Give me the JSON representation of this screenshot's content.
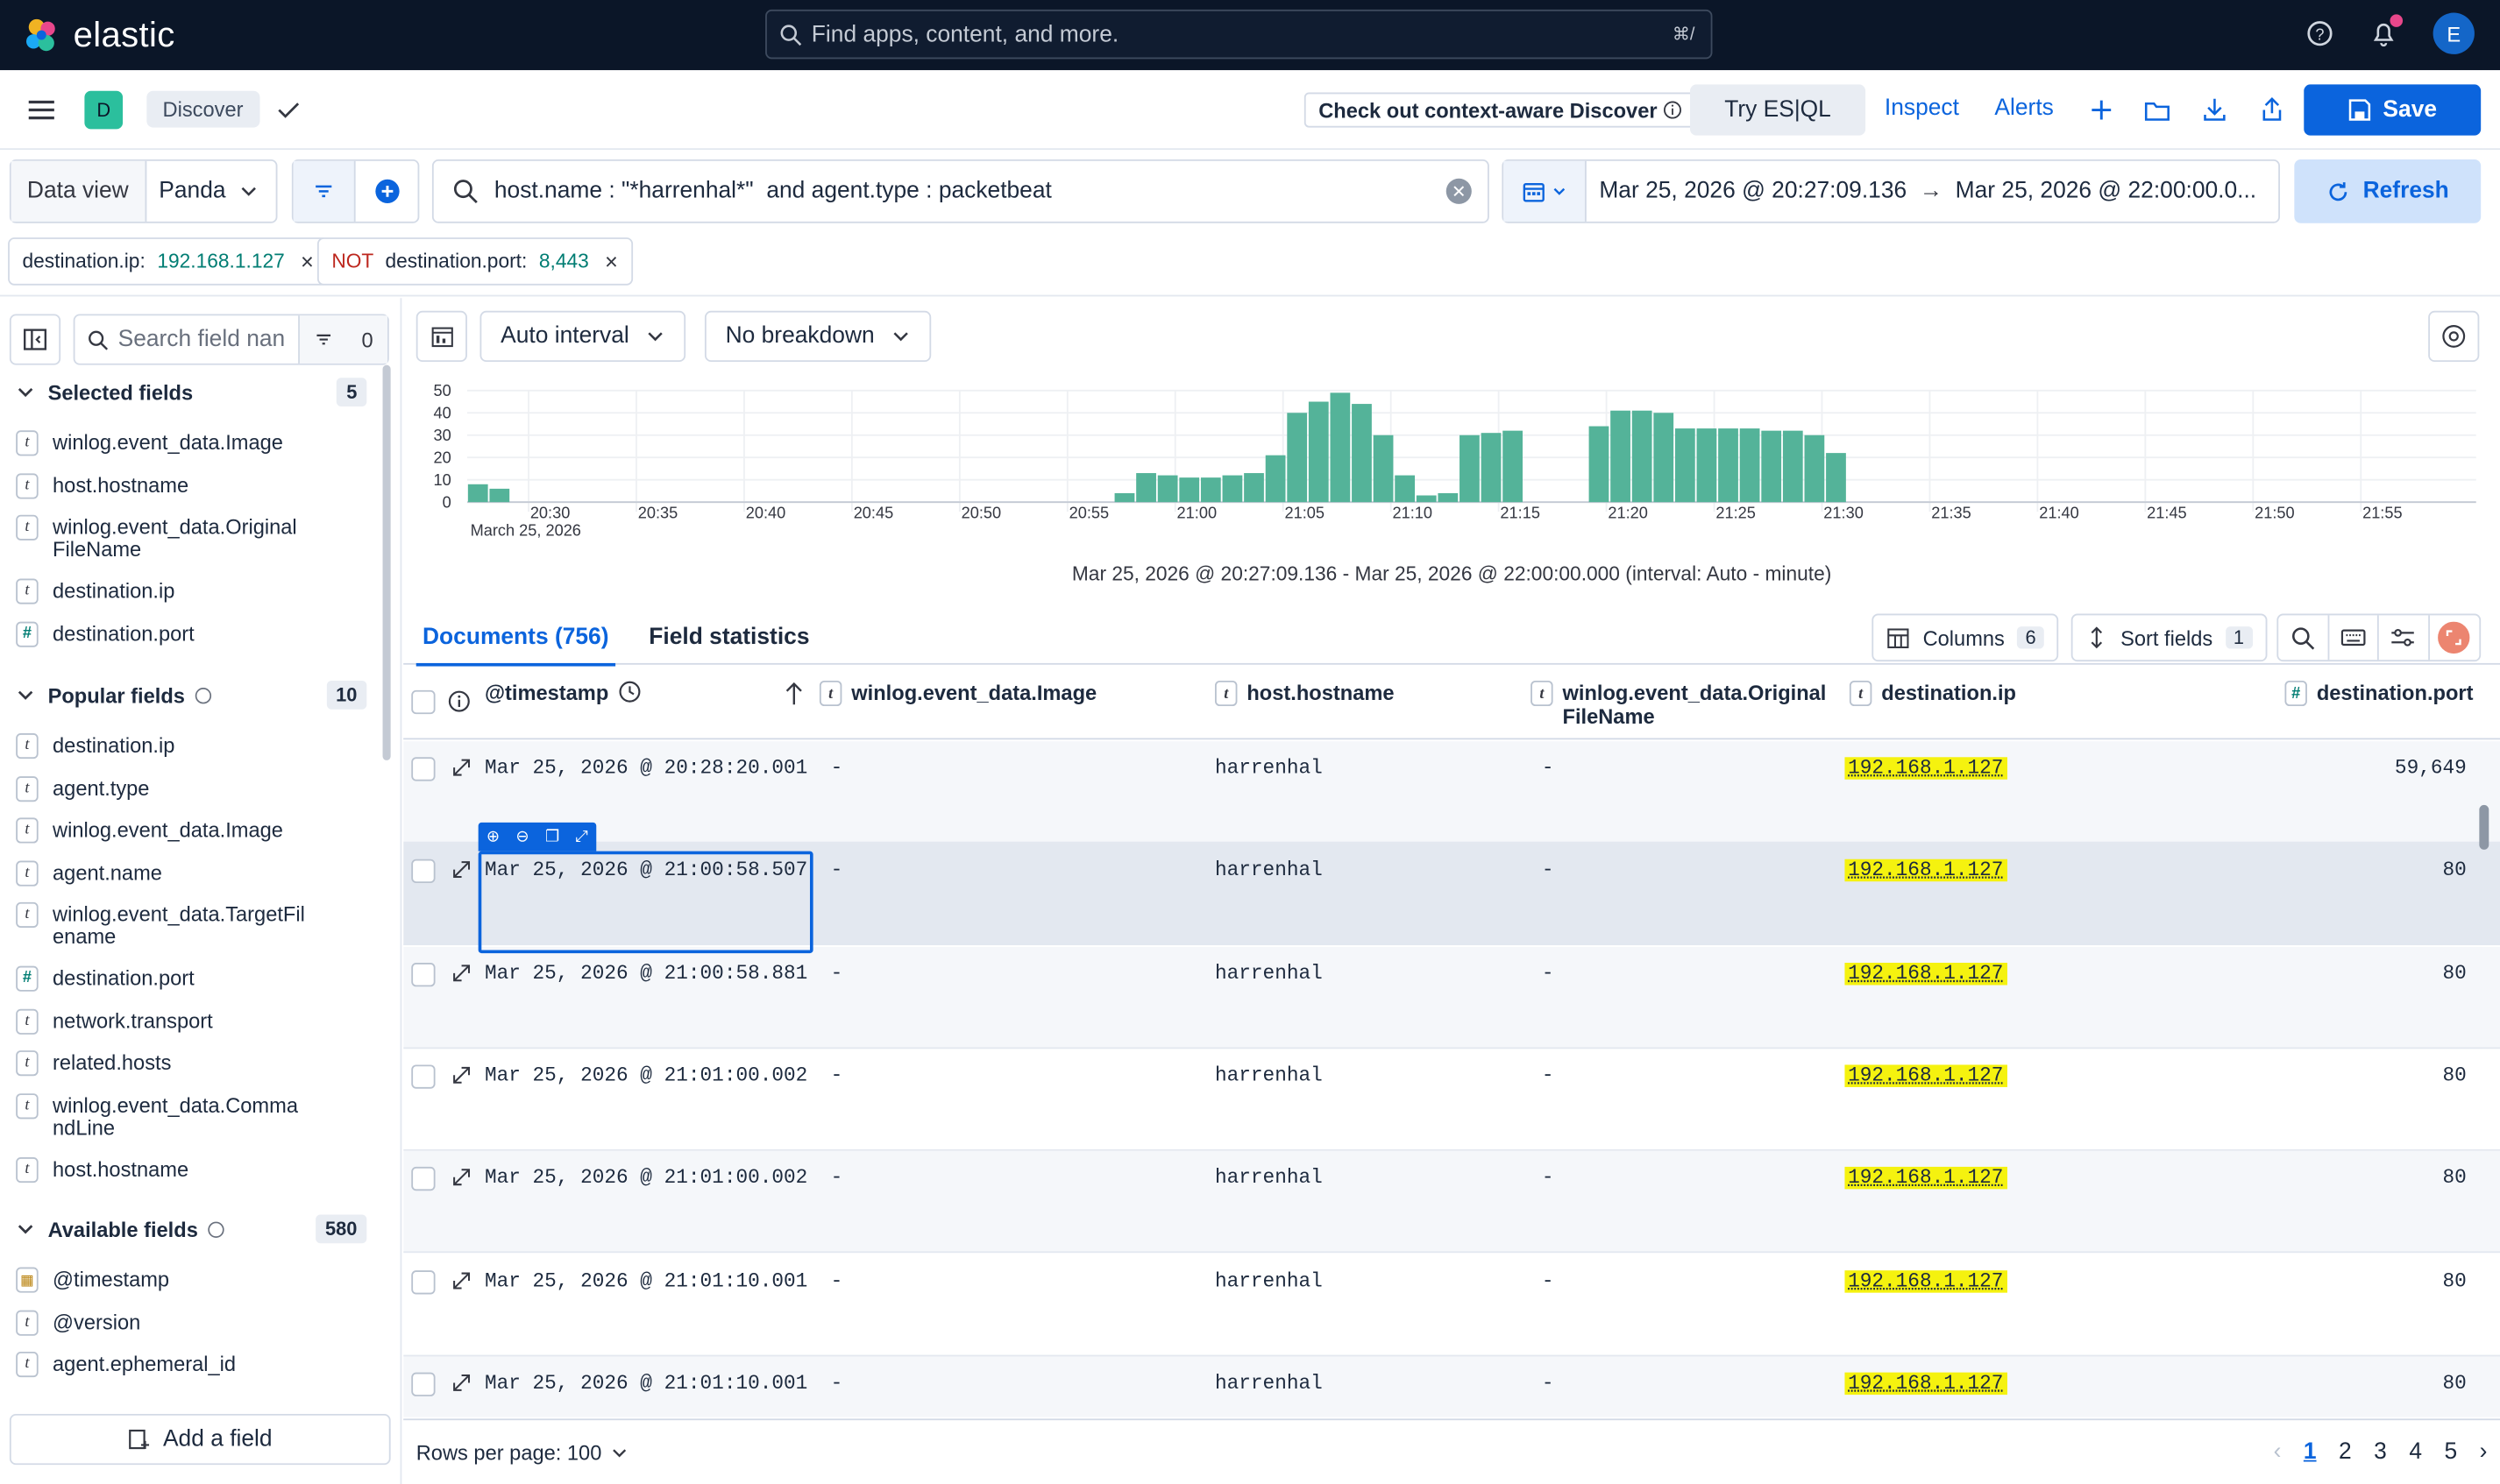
{
  "topbar": {
    "brand": "elastic",
    "search_placeholder": "Find apps, content, and more.",
    "search_shortcut": "⌘/",
    "user_initial": "E"
  },
  "appbar": {
    "space_initial": "D",
    "breadcrumb": "Discover",
    "context_link": "Check out context-aware Discover",
    "try_esql": "Try ES|QL",
    "inspect": "Inspect",
    "alerts": "Alerts",
    "save": "Save"
  },
  "querybar": {
    "data_view_label": "Data view",
    "data_view_value": "Panda",
    "query": "host.name : \"*harrenhal*\"  and agent.type : packetbeat",
    "date_start": "Mar 25, 2026 @ 20:27:09.136",
    "date_end": "Mar 25, 2026 @ 22:00:00.0...",
    "refresh": "Refresh"
  },
  "filters": [
    {
      "prefix": "",
      "field": "destination.ip: ",
      "value": "192.168.1.127"
    },
    {
      "prefix": "NOT ",
      "field": "destination.port: ",
      "value": "8,443"
    }
  ],
  "sidebar": {
    "search_placeholder": "Search field nan",
    "filter_count": "0",
    "selected": {
      "title": "Selected fields",
      "count": "5",
      "fields": [
        {
          "type": "t",
          "name": "winlog.event_data.Image"
        },
        {
          "type": "t",
          "name": "host.hostname"
        },
        {
          "type": "t",
          "name": "winlog.event_data.OriginalFileName"
        },
        {
          "type": "t",
          "name": "destination.ip"
        },
        {
          "type": "#",
          "name": "destination.port"
        }
      ]
    },
    "popular": {
      "title": "Popular fields",
      "count": "10",
      "fields": [
        {
          "type": "t",
          "name": "destination.ip"
        },
        {
          "type": "t",
          "name": "agent.type"
        },
        {
          "type": "t",
          "name": "winlog.event_data.Image"
        },
        {
          "type": "t",
          "name": "agent.name"
        },
        {
          "type": "t",
          "name": "winlog.event_data.TargetFilename"
        },
        {
          "type": "#",
          "name": "destination.port"
        },
        {
          "type": "t",
          "name": "network.transport"
        },
        {
          "type": "t",
          "name": "related.hosts"
        },
        {
          "type": "t",
          "name": "winlog.event_data.CommandLine"
        },
        {
          "type": "t",
          "name": "host.hostname"
        }
      ]
    },
    "available": {
      "title": "Available fields",
      "count": "580",
      "fields": [
        {
          "type": "date",
          "name": "@timestamp"
        },
        {
          "type": "t",
          "name": "@version"
        },
        {
          "type": "t",
          "name": "agent.ephemeral_id"
        }
      ]
    },
    "add_field": "Add a field"
  },
  "chart_toolbar": {
    "interval": "Auto interval",
    "breakdown": "No breakdown"
  },
  "chart_data": {
    "type": "bar",
    "y_ticks": [
      "50",
      "40",
      "30",
      "20",
      "10",
      "0"
    ],
    "ylim": [
      0,
      50
    ],
    "x_ticks": [
      "20:30",
      "20:35",
      "20:40",
      "20:45",
      "20:50",
      "20:55",
      "21:00",
      "21:05",
      "21:10",
      "21:15",
      "21:20",
      "21:25",
      "21:30",
      "21:35",
      "21:40",
      "21:45",
      "21:50",
      "21:55"
    ],
    "x_sublabel": "March 25, 2026",
    "minute_offsets": [
      0,
      1,
      30,
      31,
      32,
      33,
      34,
      35,
      36,
      37,
      38,
      39,
      40,
      41,
      42,
      43,
      44,
      45,
      46,
      47,
      48,
      52,
      53,
      54,
      55,
      56,
      57,
      58,
      59,
      60,
      61,
      62,
      63
    ],
    "values": [
      8,
      6,
      4,
      13,
      12,
      11,
      11,
      12,
      13,
      21,
      40,
      45,
      49,
      44,
      30,
      12,
      3,
      4,
      30,
      31,
      32,
      34,
      41,
      41,
      40,
      33,
      33,
      33,
      33,
      32,
      32,
      30,
      22
    ],
    "caption": "Mar 25, 2026 @ 20:27:09.136 - Mar 25, 2026 @ 22:00:00.000 (interval: Auto - minute)",
    "bar_color": "#54b399"
  },
  "tabs": {
    "documents": "Documents (756)",
    "field_stats": "Field statistics"
  },
  "grid": {
    "columns_label": "Columns",
    "columns_count": "6",
    "sort_label": "Sort fields",
    "sort_count": "1",
    "headers": {
      "timestamp": "@timestamp",
      "image": "winlog.event_data.Image",
      "hostname": "host.hostname",
      "original": "winlog.event_data.OriginalFileName",
      "dest_ip": "destination.ip",
      "dest_port": "destination.port"
    },
    "rows": [
      {
        "ts": "Mar 25, 2026 @ 20:28:20.001",
        "image": "-",
        "host": "harrenhal",
        "orig": "-",
        "ip": "192.168.1.127",
        "port": "59,649"
      },
      {
        "ts": "Mar 25, 2026 @ 21:00:58.507",
        "image": "-",
        "host": "harrenhal",
        "orig": "-",
        "ip": "192.168.1.127",
        "port": "80"
      },
      {
        "ts": "Mar 25, 2026 @ 21:00:58.881",
        "image": "-",
        "host": "harrenhal",
        "orig": "-",
        "ip": "192.168.1.127",
        "port": "80"
      },
      {
        "ts": "Mar 25, 2026 @ 21:01:00.002",
        "image": "-",
        "host": "harrenhal",
        "orig": "-",
        "ip": "192.168.1.127",
        "port": "80"
      },
      {
        "ts": "Mar 25, 2026 @ 21:01:00.002",
        "image": "-",
        "host": "harrenhal",
        "orig": "-",
        "ip": "192.168.1.127",
        "port": "80"
      },
      {
        "ts": "Mar 25, 2026 @ 21:01:10.001",
        "image": "-",
        "host": "harrenhal",
        "orig": "-",
        "ip": "192.168.1.127",
        "port": "80"
      },
      {
        "ts": "Mar 25, 2026 @ 21:01:10.001",
        "image": "-",
        "host": "harrenhal",
        "orig": "-",
        "ip": "192.168.1.127",
        "port": "80"
      }
    ],
    "rows_per_page": "Rows per page: 100",
    "pages": [
      "1",
      "2",
      "3",
      "4",
      "5"
    ]
  }
}
